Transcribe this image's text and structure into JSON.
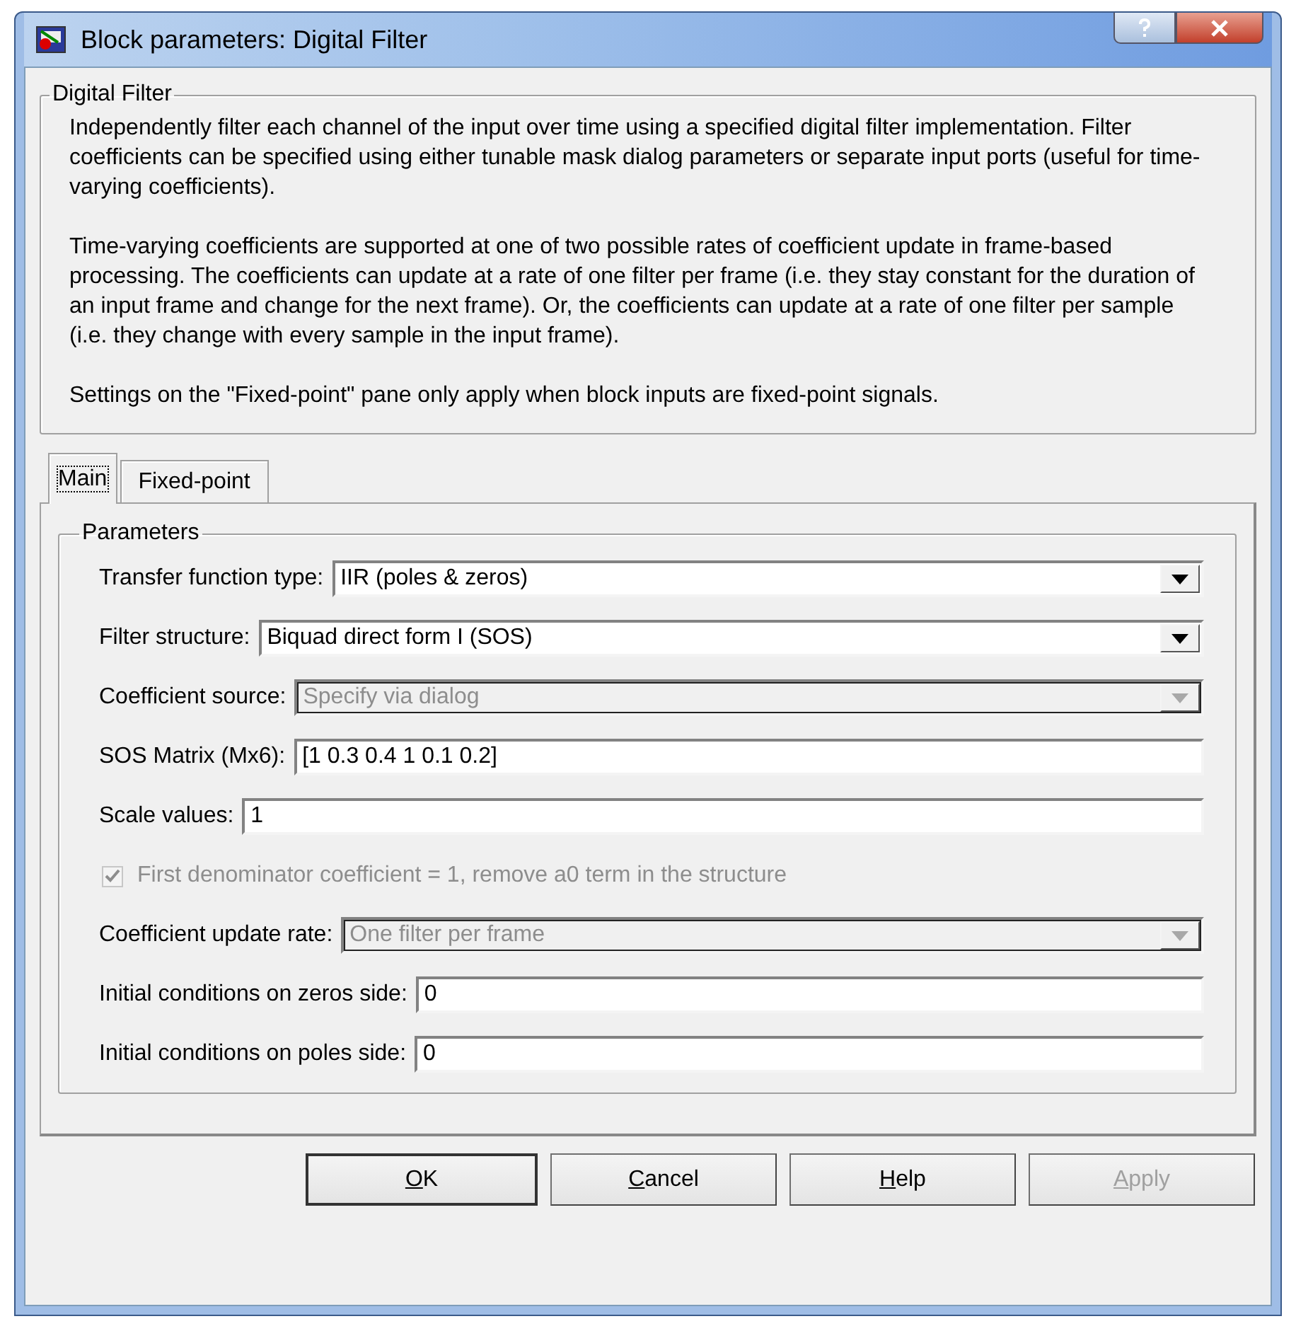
{
  "window": {
    "title": "Block parameters: Digital Filter"
  },
  "description": {
    "title": "Digital Filter",
    "paragraphs": [
      "Independently filter each channel of the input over time using a specified digital filter implementation.  Filter coefficients can be specified using either tunable mask dialog parameters or separate input ports (useful for time-varying coefficients).",
      "Time-varying coefficients are supported at one of two possible rates of coefficient update in frame-based processing.  The coefficients can update at a rate of one filter per frame (i.e. they stay constant for the duration of an input frame and change for the next frame).  Or, the coefficients can update at a rate of one filter per sample (i.e. they change with every sample in the input frame).",
      "Settings on the \"Fixed-point\" pane only apply when block inputs are fixed-point signals."
    ]
  },
  "tabs": [
    {
      "label": "Main",
      "selected": true
    },
    {
      "label": "Fixed-point",
      "selected": false
    }
  ],
  "parameters": {
    "title": "Parameters",
    "rows": [
      {
        "kind": "select",
        "label": "Transfer function type:",
        "value": "IIR (poles & zeros)",
        "disabled": false
      },
      {
        "kind": "select",
        "label": "Filter structure:",
        "value": "Biquad direct form I (SOS)",
        "disabled": false
      },
      {
        "kind": "select",
        "label": "Coefficient source:",
        "value": "Specify via dialog",
        "disabled": true
      },
      {
        "kind": "text",
        "label": "SOS Matrix (Mx6):",
        "value": "[1 0.3 0.4 1 0.1 0.2]",
        "disabled": false
      },
      {
        "kind": "text",
        "label": "Scale values:",
        "value": "1",
        "disabled": false
      },
      {
        "kind": "checkbox",
        "label": "First denominator coefficient = 1, remove a0 term in the structure",
        "checked": true,
        "disabled": true
      },
      {
        "kind": "select",
        "label": "Coefficient update rate:",
        "value": "One filter per frame",
        "disabled": true
      },
      {
        "kind": "text",
        "label": "Initial conditions on zeros side:",
        "value": "0",
        "disabled": false
      },
      {
        "kind": "text",
        "label": "Initial conditions on poles side:",
        "value": "0",
        "disabled": false
      }
    ]
  },
  "buttons": [
    {
      "mnemonic": "O",
      "rest": "K",
      "disabled": false,
      "default": true
    },
    {
      "mnemonic": "C",
      "rest": "ancel",
      "disabled": false,
      "default": false
    },
    {
      "mnemonic": "H",
      "rest": "elp",
      "disabled": false,
      "default": false
    },
    {
      "mnemonic": "A",
      "rest": "pply",
      "disabled": true,
      "default": false
    }
  ]
}
